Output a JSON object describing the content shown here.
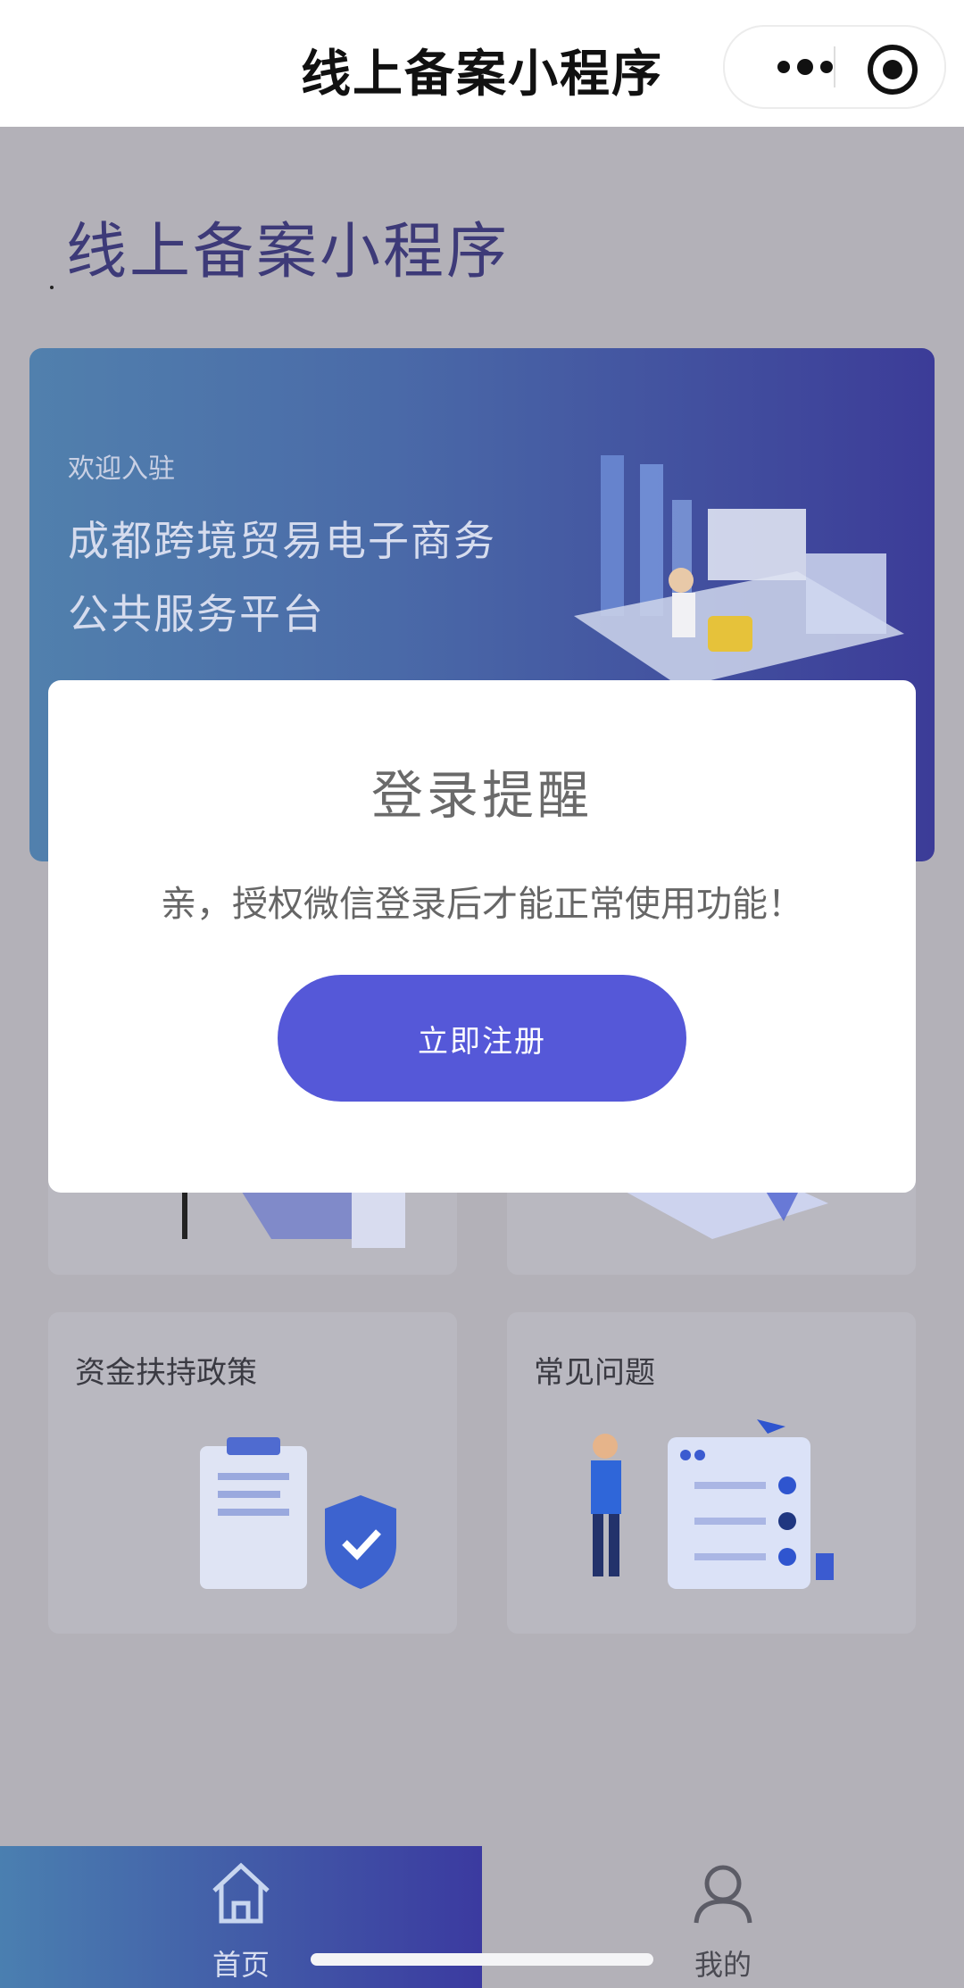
{
  "navbar": {
    "title": "线上备案小程序"
  },
  "page": {
    "title": "线上备案小程序"
  },
  "banner": {
    "welcome": "欢迎入驻",
    "line1": "成都跨境贸易电子商务",
    "line2": "公共服务平台"
  },
  "cards": [
    {
      "label": ""
    },
    {
      "label": ""
    },
    {
      "label": "资金扶持政策"
    },
    {
      "label": "常见问题"
    }
  ],
  "modal": {
    "title": "登录提醒",
    "message": "亲，授权微信登录后才能正常使用功能！",
    "button": "立即注册"
  },
  "tabbar": {
    "items": [
      {
        "label": "首页",
        "icon": "home-icon",
        "active": true
      },
      {
        "label": "我的",
        "icon": "user-icon",
        "active": false
      }
    ]
  },
  "colors": {
    "accent": "#5558d8",
    "banner_start": "#5180ad",
    "banner_end": "#3c3c98"
  }
}
